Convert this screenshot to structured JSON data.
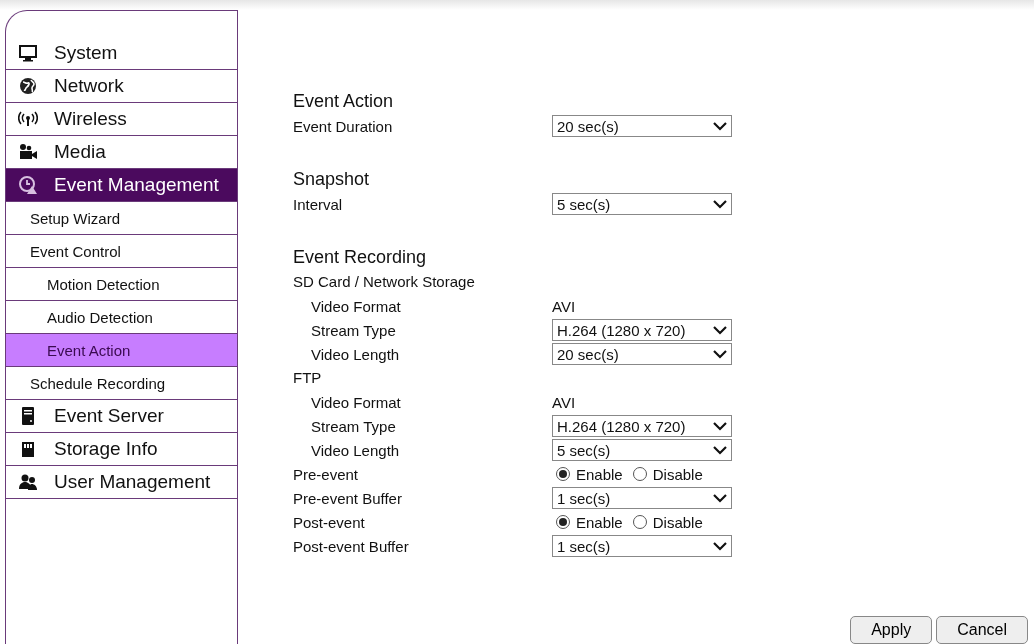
{
  "sidebar": {
    "items": [
      {
        "label": "System",
        "selected": false
      },
      {
        "label": "Network",
        "selected": false
      },
      {
        "label": "Wireless",
        "selected": false
      },
      {
        "label": "Media",
        "selected": false
      },
      {
        "label": "Event Management",
        "selected": true,
        "children": [
          {
            "label": "Setup Wizard",
            "selected": false
          },
          {
            "label": "Event Control",
            "selected": false,
            "children": [
              {
                "label": "Motion Detection",
                "selected": false
              },
              {
                "label": "Audio Detection",
                "selected": false
              },
              {
                "label": "Event Action",
                "selected": true
              }
            ]
          },
          {
            "label": "Schedule Recording",
            "selected": false
          }
        ]
      },
      {
        "label": "Event Server",
        "selected": false
      },
      {
        "label": "Storage Info",
        "selected": false
      },
      {
        "label": "User Management",
        "selected": false
      }
    ]
  },
  "sections": [
    {
      "title": "Event Action",
      "rows": [
        {
          "kind": "select",
          "label": "Event Duration",
          "value": "20 sec(s)"
        }
      ]
    },
    {
      "title": "Snapshot",
      "rows": [
        {
          "kind": "select",
          "label": "Interval",
          "value": "5 sec(s)"
        }
      ]
    },
    {
      "title": "Event Recording",
      "rows": [
        {
          "kind": "group",
          "label": "SD Card / Network Storage",
          "children": [
            {
              "kind": "text",
              "label": "Video Format",
              "value": "AVI"
            },
            {
              "kind": "select",
              "label": "Stream Type",
              "value": "H.264 (1280 x 720)"
            },
            {
              "kind": "select",
              "label": "Video Length",
              "value": "20 sec(s)"
            }
          ]
        },
        {
          "kind": "group",
          "label": "FTP",
          "children": [
            {
              "kind": "text",
              "label": "Video Format",
              "value": "AVI"
            },
            {
              "kind": "select",
              "label": "Stream Type",
              "value": "H.264 (1280 x 720)"
            },
            {
              "kind": "select",
              "label": "Video Length",
              "value": "5 sec(s)"
            }
          ]
        },
        {
          "kind": "radio",
          "label": "Pre-event",
          "options": [
            {
              "label": "Enable",
              "selected": true
            },
            {
              "label": "Disable",
              "selected": false
            }
          ]
        },
        {
          "kind": "select",
          "label": "Pre-event Buffer",
          "value": "1 sec(s)"
        },
        {
          "kind": "radio",
          "label": "Post-event",
          "options": [
            {
              "label": "Enable",
              "selected": true
            },
            {
              "label": "Disable",
              "selected": false
            }
          ]
        },
        {
          "kind": "select",
          "label": "Post-event Buffer",
          "value": "1 sec(s)"
        }
      ]
    }
  ],
  "buttons": [
    "Apply",
    "Cancel"
  ]
}
